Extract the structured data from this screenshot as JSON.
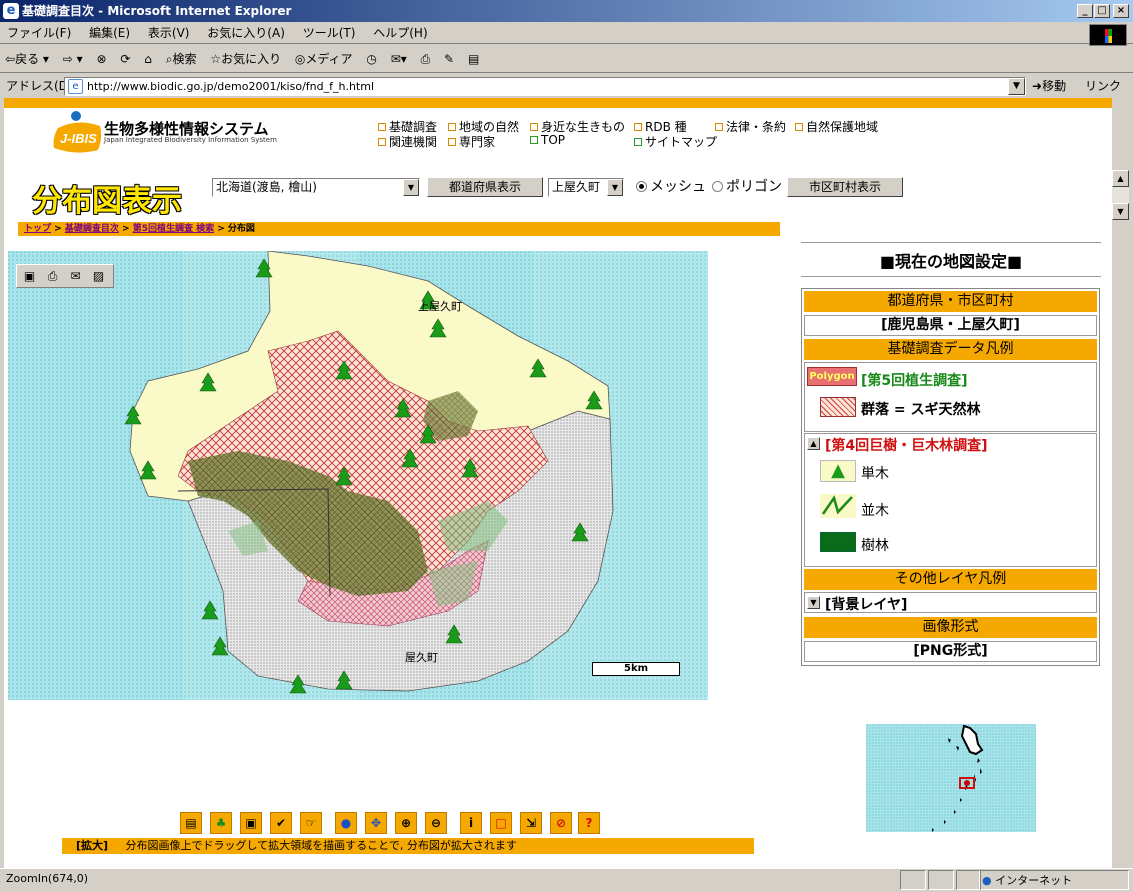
{
  "window": {
    "title": "基礎調査目次 - Microsoft Internet Explorer"
  },
  "menu": [
    "ファイル(F)",
    "編集(E)",
    "表示(V)",
    "お気に入り(A)",
    "ツール(T)",
    "ヘルプ(H)"
  ],
  "toolbar": {
    "back": "戻る",
    "search": "検索",
    "favorites": "お気に入り",
    "media": "メディア"
  },
  "address": {
    "label": "アドレス(D)",
    "url": "http://www.biodic.go.jp/demo2001/kiso/fnd_f_h.html",
    "go": "移動",
    "links": "リンク"
  },
  "site": {
    "logo": "J-IBIS",
    "name": "生物多様性情報システム",
    "subname": "Japan Integrated Biodiversity Information System"
  },
  "nav": {
    "row1": [
      "基礎調査",
      "地域の自然",
      "身近な生きもの",
      "RDB 種",
      "法律・条約",
      "自然保護地域"
    ],
    "row2": [
      "関連機関",
      "専門家",
      "TOP",
      "サイトマップ"
    ]
  },
  "controls": {
    "page_title": "分布図表示",
    "prefecture_select": "北海道(渡島, 檜山)",
    "prefecture_button": "都道府県表示",
    "city_select": "上屋久町",
    "radio_mesh": "メッシュ",
    "radio_polygon": "ポリゴン",
    "city_button": "市区町村表示"
  },
  "breadcrumb": {
    "top": "トップ",
    "sep": ">",
    "index": "基礎調査目次",
    "search": "第5回植生調査 検索",
    "current": "分布図"
  },
  "map": {
    "label_north": "上屋久町",
    "label_south": "屋久町",
    "scale": "5km"
  },
  "panel": {
    "title": "■現在の地図設定■",
    "pref_header": "都道府県・市区町村",
    "pref_value": "[鹿児島県・上屋久町]",
    "legend_header": "基礎調査データ凡例",
    "survey5_badge": "Polygon",
    "survey5": "[第5回植生調査]",
    "survey5_item": "群落 = スギ天然林",
    "survey4": "[第4回巨樹・巨木林調査]",
    "tree_single": "単木",
    "tree_row": "並木",
    "tree_forest": "樹林",
    "other_header": "その他レイヤ凡例",
    "bg_layer": "[背景レイヤ]",
    "image_header": "画像形式",
    "image_value": "[PNG形式]"
  },
  "help": {
    "mode": "[拡大]",
    "text": "分布図画像上でドラッグして拡大領域を描画することで, 分布図が拡大されます"
  },
  "status": {
    "text": "ZoomIn(674,0)",
    "zone": "インターネット"
  },
  "colors": {
    "accent": "#f5a900",
    "sea": "#8fd8e0",
    "forest": "#6b7a2e",
    "red_hatch": "#d02020"
  }
}
